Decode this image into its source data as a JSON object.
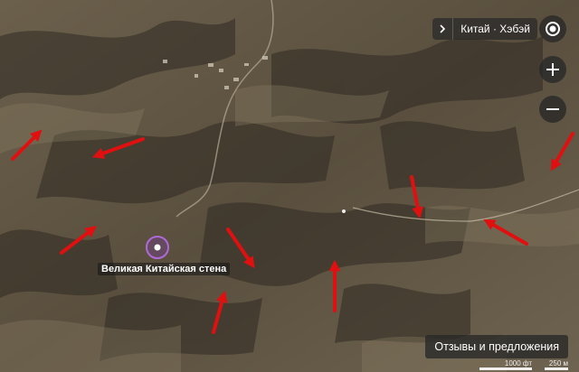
{
  "breadcrumb": {
    "text": "Китай · Хэбэй"
  },
  "poi": {
    "label": "Великая Китайская стена"
  },
  "buttons": {
    "feedback": "Отзывы и предложения"
  },
  "scale": {
    "ft": "1000 фт",
    "m": "250 м"
  },
  "colors": {
    "terrain": "#5f5443",
    "arrow": "#e01010",
    "poi": "#9b4fc4"
  },
  "icons": {
    "locate": "target-icon",
    "zoom_in": "plus-icon",
    "zoom_out": "minus-icon",
    "expand": "chevron-right-icon"
  }
}
